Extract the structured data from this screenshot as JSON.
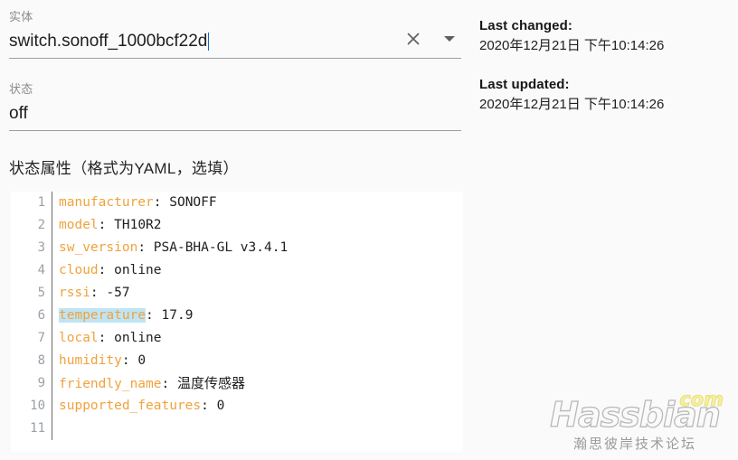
{
  "entity_field": {
    "label": "实体",
    "value": "switch.sonoff_1000bcf22d",
    "clear_icon": "close-icon",
    "dropdown_icon": "chevron-down-icon"
  },
  "state_field": {
    "label": "状态",
    "value": "off"
  },
  "attributes": {
    "label": "状态属性（格式为YAML，选填）",
    "editor": {
      "lines": [
        {
          "n": "1",
          "key": "manufacturer",
          "sep": ": ",
          "value": "SONOFF",
          "selected": false
        },
        {
          "n": "2",
          "key": "model",
          "sep": ": ",
          "value": "TH10R2",
          "selected": false
        },
        {
          "n": "3",
          "key": "sw_version",
          "sep": ": ",
          "value": "PSA-BHA-GL v3.4.1",
          "selected": false
        },
        {
          "n": "4",
          "key": "cloud",
          "sep": ": ",
          "value": "online",
          "selected": false
        },
        {
          "n": "5",
          "key": "rssi",
          "sep": ": ",
          "value": "-57",
          "selected": false
        },
        {
          "n": "6",
          "key": "temperature",
          "sep": ": ",
          "value": "17.9",
          "selected": true
        },
        {
          "n": "7",
          "key": "local",
          "sep": ": ",
          "value": "online",
          "selected": false
        },
        {
          "n": "8",
          "key": "humidity",
          "sep": ": ",
          "value": "0",
          "selected": false
        },
        {
          "n": "9",
          "key": "friendly_name",
          "sep": ": ",
          "value": "温度传感器",
          "selected": false,
          "cjk": true
        },
        {
          "n": "10",
          "key": "supported_features",
          "sep": ": ",
          "value": "0",
          "selected": false
        },
        {
          "n": "11",
          "key": "",
          "sep": "",
          "value": "",
          "selected": false
        }
      ]
    }
  },
  "meta": {
    "last_changed_label": "Last changed:",
    "last_changed_value": "2020年12月21日 下午10:14:26",
    "last_updated_label": "Last updated:",
    "last_updated_value": "2020年12月21日 下午10:14:26"
  },
  "watermark": {
    "brand": "Hassbian",
    "tld": "com",
    "subtitle": "瀚思彼岸技术论坛"
  },
  "colors": {
    "key_orange": "#f0a23c",
    "selection_blue": "#bfe5f5",
    "underline_gray": "#9e9e9e",
    "page_bg": "#fafafa",
    "editor_bg": "#ffffff"
  }
}
